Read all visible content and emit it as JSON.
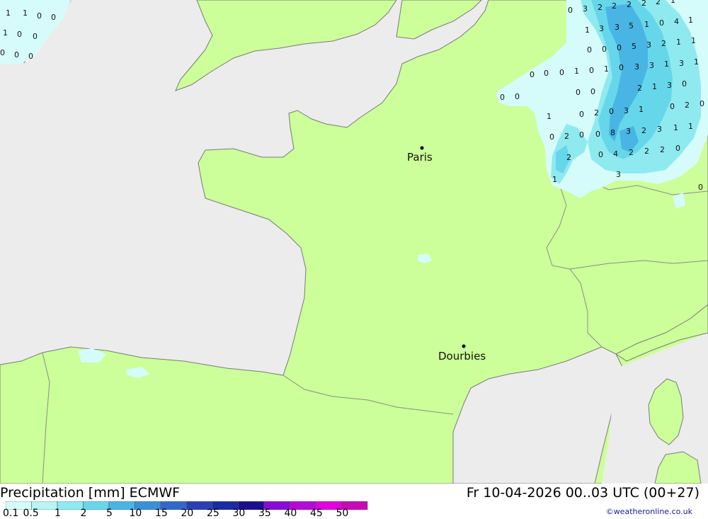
{
  "title_left": "Precipitation [mm] ECMWF",
  "title_right": "Fr 10-04-2026 00..03 UTC (00+27)",
  "credit": "©weatheronline.co.uk",
  "colors": {
    "sea": "#ececec",
    "land": "#ccff99",
    "border": "#8c8c8c",
    "coast": "#7a7a7a"
  },
  "legend": {
    "labels": [
      "0.1",
      "0.5",
      "1",
      "2",
      "5",
      "10",
      "15",
      "20",
      "25",
      "30",
      "35",
      "40",
      "45",
      "50"
    ],
    "colors": [
      "#d6fbfb",
      "#b8f5f5",
      "#8eeaef",
      "#66d6ea",
      "#48b5e4",
      "#3c90d8",
      "#3466cc",
      "#2a40b8",
      "#1c2aa4",
      "#1a0f90",
      "#8a0ad8",
      "#b40ad8",
      "#e000e0",
      "#c80ab4"
    ]
  },
  "cities": [
    {
      "name": "Paris"
    },
    {
      "name": "Dourbies"
    }
  ],
  "precip_values": [
    "1",
    "1",
    "0",
    "0",
    "1",
    "0",
    "0",
    "0",
    "0",
    "0",
    "0",
    "3",
    "2",
    "2",
    "2",
    "2",
    "2",
    "1",
    "1",
    "3",
    "3",
    "5",
    "1",
    "0",
    "4",
    "1",
    "0",
    "0",
    "0",
    "5",
    "3",
    "2",
    "1",
    "1",
    "0",
    "0",
    "0",
    "1",
    "0",
    "1",
    "0",
    "3",
    "3",
    "1",
    "3",
    "1",
    "0",
    "0",
    "0",
    "0",
    "2",
    "1",
    "3",
    "0",
    "1",
    "0",
    "2",
    "0",
    "3",
    "1",
    "0",
    "2",
    "0",
    "0",
    "2",
    "0",
    "0",
    "8",
    "3",
    "2",
    "3",
    "1",
    "1",
    "2",
    "0",
    "4",
    "2",
    "2",
    "2",
    "0",
    "3",
    "1",
    "0"
  ]
}
